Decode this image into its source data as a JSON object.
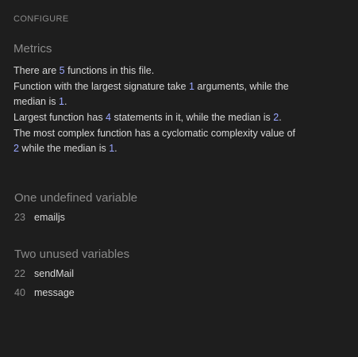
{
  "header": {
    "configure_label": "CONFIGURE"
  },
  "metrics": {
    "title": "Metrics",
    "line1": {
      "a": "There are ",
      "n": "5",
      "b": " functions in this file."
    },
    "line2": {
      "a": "Function with the largest signature take ",
      "n1": "1",
      "b": " arguments, while the median is ",
      "n2": "1",
      "c": "."
    },
    "line3": {
      "a": "Largest function has ",
      "n1": "4",
      "b": " statements in it, while the median is ",
      "n2": "2",
      "c": "."
    },
    "line4": {
      "a": "The most complex function has a cyclomatic complexity value of ",
      "n1": "2",
      "b": " while the median is ",
      "n2": "1",
      "c": "."
    }
  },
  "undefined_vars": {
    "title": "One undefined variable",
    "items": [
      {
        "line": "23",
        "name": "emailjs"
      }
    ]
  },
  "unused_vars": {
    "title": "Two unused variables",
    "items": [
      {
        "line": "22",
        "name": "sendMail"
      },
      {
        "line": "40",
        "name": "message"
      }
    ]
  },
  "colors": {
    "background": "#1e1e1e",
    "text": "#d7d7d7",
    "muted": "#8a8a8a",
    "number_accent": "#9aa7ff"
  }
}
